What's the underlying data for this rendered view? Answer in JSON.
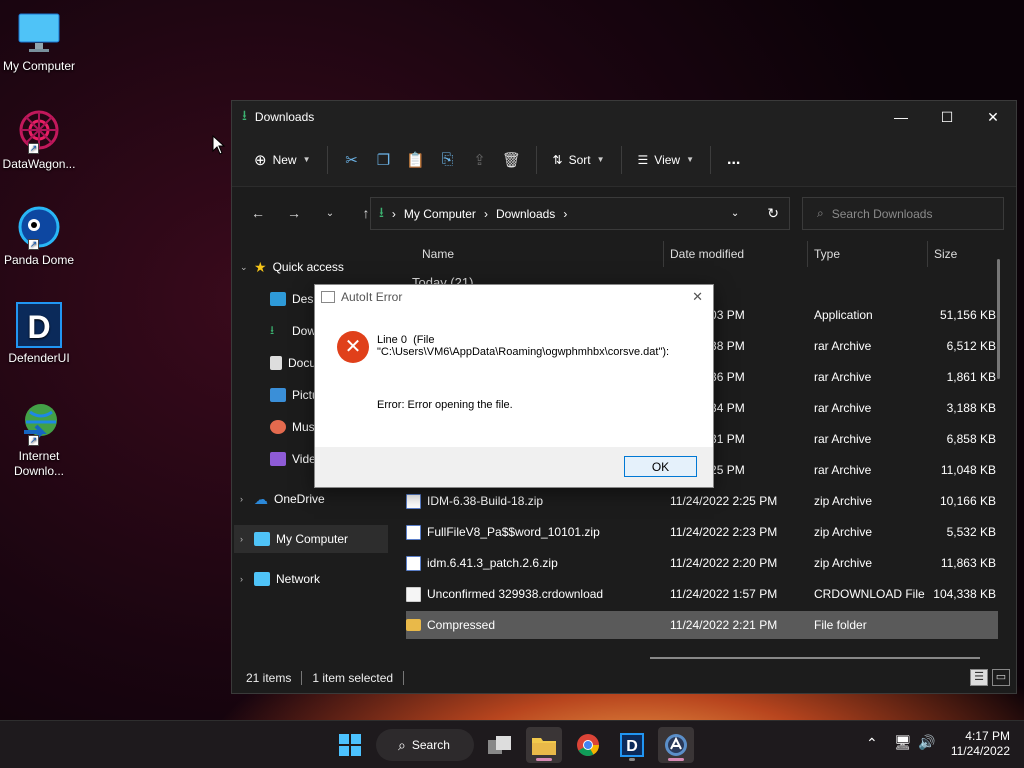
{
  "desktop": {
    "icons": [
      {
        "label": "My Computer"
      },
      {
        "label": "DataWagon..."
      },
      {
        "label": "Panda Dome"
      },
      {
        "label": "DefenderUI"
      },
      {
        "label": "Internet Downlo..."
      }
    ]
  },
  "explorer": {
    "title": "Downloads",
    "toolbar": {
      "new_label": "New",
      "sort_label": "Sort",
      "view_label": "View",
      "more_label": "..."
    },
    "address": {
      "crumb1": "My Computer",
      "crumb2": "Downloads"
    },
    "search": {
      "placeholder": "Search Downloads"
    },
    "nav": {
      "quick_access": "Quick access",
      "sub_items": [
        "Desk",
        "Dow",
        "Docu",
        "Pictu",
        "Mus",
        "Vide"
      ],
      "onedrive": "OneDrive",
      "my_computer": "My Computer",
      "network": "Network"
    },
    "columns": {
      "name": "Name",
      "date": "Date modified",
      "type": "Type",
      "size": "Size"
    },
    "group_header": "Today (21)",
    "files": [
      {
        "name": "",
        "date": "2022 4:03 PM",
        "type": "Application",
        "size": "51,156 KB"
      },
      {
        "name": "",
        "date": "2022 2:38 PM",
        "type": "rar Archive",
        "size": "6,512 KB"
      },
      {
        "name": "",
        "date": "2022 2:36 PM",
        "type": "rar Archive",
        "size": "1,861 KB"
      },
      {
        "name": "",
        "date": "2022 2:34 PM",
        "type": "rar Archive",
        "size": "3,188 KB"
      },
      {
        "name": "",
        "date": "2022 2:31 PM",
        "type": "rar Archive",
        "size": "6,858 KB"
      },
      {
        "name": "",
        "date": "2022 2:25 PM",
        "type": "rar Archive",
        "size": "11,048 KB"
      },
      {
        "name": "IDM-6.38-Build-18.zip",
        "date": "11/24/2022 2:25 PM",
        "type": "zip Archive",
        "size": "10,166 KB"
      },
      {
        "name": "FullFileV8_Pa$$word_10101.zip",
        "date": "11/24/2022 2:23 PM",
        "type": "zip Archive",
        "size": "5,532 KB"
      },
      {
        "name": "idm.6.41.3_patch.2.6.zip",
        "date": "11/24/2022 2:20 PM",
        "type": "zip Archive",
        "size": "11,863 KB"
      },
      {
        "name": "Unconfirmed 329938.crdownload",
        "date": "11/24/2022 1:57 PM",
        "type": "CRDOWNLOAD File",
        "size": "104,338 KB"
      },
      {
        "name": "Compressed",
        "date": "11/24/2022 2:21 PM",
        "type": "File folder",
        "size": ""
      }
    ],
    "status": {
      "count": "21 items",
      "selected": "1 item selected"
    }
  },
  "dialog": {
    "title": "AutoIt Error",
    "line1": "Line 0  (File",
    "line2": "\"C:\\Users\\VM6\\AppData\\Roaming\\ogwphmhbx\\corsve.dat\"):",
    "error": "Error: Error opening the file.",
    "ok_label": "OK"
  },
  "taskbar": {
    "search_label": "Search",
    "time": "4:17 PM",
    "date": "11/24/2022"
  },
  "colors": {
    "accent": "#0078d4",
    "selected_row": "#5a5a5a",
    "error_red": "#e0401a"
  }
}
